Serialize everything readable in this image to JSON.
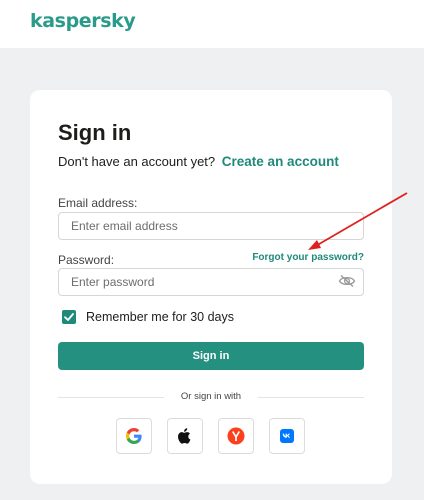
{
  "brand": {
    "logo_text": "kaspersky",
    "accent_color": "#2a9b8a",
    "button_color": "#249080",
    "annotation_color": "#e0201e"
  },
  "signin": {
    "title": "Sign in",
    "no_account_text": "Don't have an account yet?",
    "create_account_link": "Create an account",
    "email_label": "Email address:",
    "email_placeholder": "Enter email address",
    "email_value": "",
    "password_label": "Password:",
    "password_placeholder": "Enter password",
    "password_value": "",
    "forgot_password_link": "Forgot your password?",
    "password_toggle_icon": "eye-slash-icon",
    "remember_label": "Remember me for 30 days",
    "remember_checked": true,
    "submit_label": "Sign in",
    "or_label": "Or sign in with"
  },
  "social_providers": [
    {
      "name": "Google",
      "icon": "google-icon"
    },
    {
      "name": "Apple",
      "icon": "apple-icon"
    },
    {
      "name": "Yandex",
      "icon": "yandex-icon"
    },
    {
      "name": "VK",
      "icon": "vk-icon"
    }
  ],
  "annotation": {
    "type": "red arrow",
    "points_to": "forgot-password-link"
  }
}
